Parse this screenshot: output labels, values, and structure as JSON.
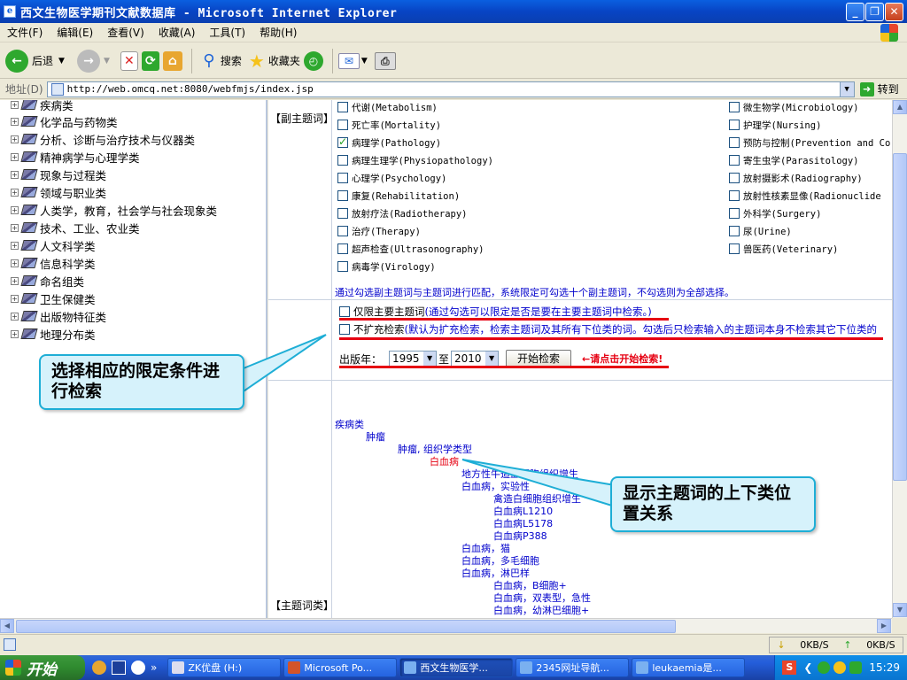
{
  "window": {
    "title": "西文生物医学期刊文献数据库 - Microsoft Internet Explorer",
    "menu": [
      "文件(F)",
      "编辑(E)",
      "查看(V)",
      "收藏(A)",
      "工具(T)",
      "帮助(H)"
    ]
  },
  "toolbar": {
    "back": "后退",
    "search": "搜索",
    "favorites": "收藏夹"
  },
  "address": {
    "label": "地址(D)",
    "url": "http://web.omcq.net:8080/webfmjs/index.jsp",
    "go": "转到"
  },
  "tree": [
    "疾病类",
    "化学品与药物类",
    "分析、诊断与治疗技术与仪器类",
    "精神病学与心理学类",
    "现象与过程类",
    "领域与职业类",
    "人类学，教育，社会学与社会现象类",
    "技术、工业、农业类",
    "人文科学类",
    "信息科学类",
    "命名组类",
    "卫生保健类",
    "出版物特征类",
    "地理分布类"
  ],
  "subheadings": {
    "section_label": "【副主题词】",
    "left_col": [
      {
        "text": "代谢(Metabolism)",
        "checked": false
      },
      {
        "text": "死亡率(Mortality)",
        "checked": false
      },
      {
        "text": "病理学(Pathology)",
        "checked": true
      },
      {
        "text": "病理生理学(Physiopathology)",
        "checked": false
      },
      {
        "text": "心理学(Psychology)",
        "checked": false
      },
      {
        "text": "康复(Rehabilitation)",
        "checked": false
      },
      {
        "text": "放射疗法(Radiotherapy)",
        "checked": false
      },
      {
        "text": "治疗(Therapy)",
        "checked": false
      },
      {
        "text": "超声检查(Ultrasonography)",
        "checked": false
      },
      {
        "text": "病毒学(Virology)",
        "checked": false
      }
    ],
    "right_col": [
      {
        "text": "微生物学(Microbiology)",
        "checked": false
      },
      {
        "text": "护理学(Nursing)",
        "checked": false
      },
      {
        "text": "预防与控制(Prevention and Co",
        "checked": false
      },
      {
        "text": "寄生虫学(Parasitology)",
        "checked": false
      },
      {
        "text": "放射摄影术(Radiography)",
        "checked": false
      },
      {
        "text": "放射性核素显像(Radionuclide",
        "checked": false
      },
      {
        "text": "外科学(Surgery)",
        "checked": false
      },
      {
        "text": "尿(Urine)",
        "checked": false
      },
      {
        "text": "兽医药(Veterinary)",
        "checked": false
      }
    ],
    "note": "通过勾选副主题词与主题词进行匹配，系统限定可勾选十个副主题词，不勾选则为全部选择。"
  },
  "limits": {
    "major_only_label": "仅限主要主题词",
    "major_only_hint": "(通过勾选可以限定是否是要在主要主题词中检索。)",
    "no_expand_label": "不扩充检索",
    "no_expand_hint": "(默认为扩充检索，检索主题词及其所有下位类的词。勾选后只检索输入的主题词本身不检索其它下位类的",
    "year_label": "出版年：",
    "year_from": "1995",
    "year_to_label": "至",
    "year_to": "2010",
    "search_button": "开始检索",
    "search_hint": "←请点击开始检索!"
  },
  "hierarchy": {
    "section_label": "【主题词类】",
    "items": [
      {
        "text": "疾病类",
        "level": 0,
        "highlight": false
      },
      {
        "text": "肿瘤",
        "level": 1,
        "highlight": false
      },
      {
        "text": "肿瘤, 组织学类型",
        "level": 2,
        "highlight": false
      },
      {
        "text": "白血病",
        "level": 3,
        "highlight": true
      },
      {
        "text": "地方性牛造血细胞组织增生",
        "level": 4,
        "highlight": false
      },
      {
        "text": "白血病，实验性",
        "level": 4,
        "highlight": false
      },
      {
        "text": "禽造白细胞组织增生",
        "level": 5,
        "highlight": false
      },
      {
        "text": "白血病L1210",
        "level": 5,
        "highlight": false
      },
      {
        "text": "白血病L5178",
        "level": 5,
        "highlight": false
      },
      {
        "text": "白血病P388",
        "level": 5,
        "highlight": false
      },
      {
        "text": "白血病，猫",
        "level": 4,
        "highlight": false
      },
      {
        "text": "白血病，多毛细胞",
        "level": 4,
        "highlight": false
      },
      {
        "text": "白血病，淋巴样",
        "level": 4,
        "highlight": false
      },
      {
        "text": "白血病，B细胞+",
        "level": 5,
        "highlight": false
      },
      {
        "text": "白血病，双表型，急性",
        "level": 5,
        "highlight": false
      },
      {
        "text": "白血病，幼淋巴细胞+",
        "level": 5,
        "highlight": false
      }
    ]
  },
  "callouts": {
    "limits": "选择相应的限定条件进行检索",
    "hierarchy": "显示主题词的上下类位置关系"
  },
  "status": {
    "down_rate": "0KB/S",
    "up_rate": "0KB/S"
  },
  "taskbar": {
    "start": "开始",
    "tasks": [
      "ZK优盘 (H:)",
      "Microsoft Po...",
      "西文生物医学...",
      "2345网址导航...",
      "leukaemia是..."
    ],
    "clock": "15:29"
  },
  "colors": {
    "link_blue": "#0000cc",
    "highlight_red": "#e60012",
    "callout_border": "#1eaed6",
    "callout_fill": "#d6f2fb"
  }
}
